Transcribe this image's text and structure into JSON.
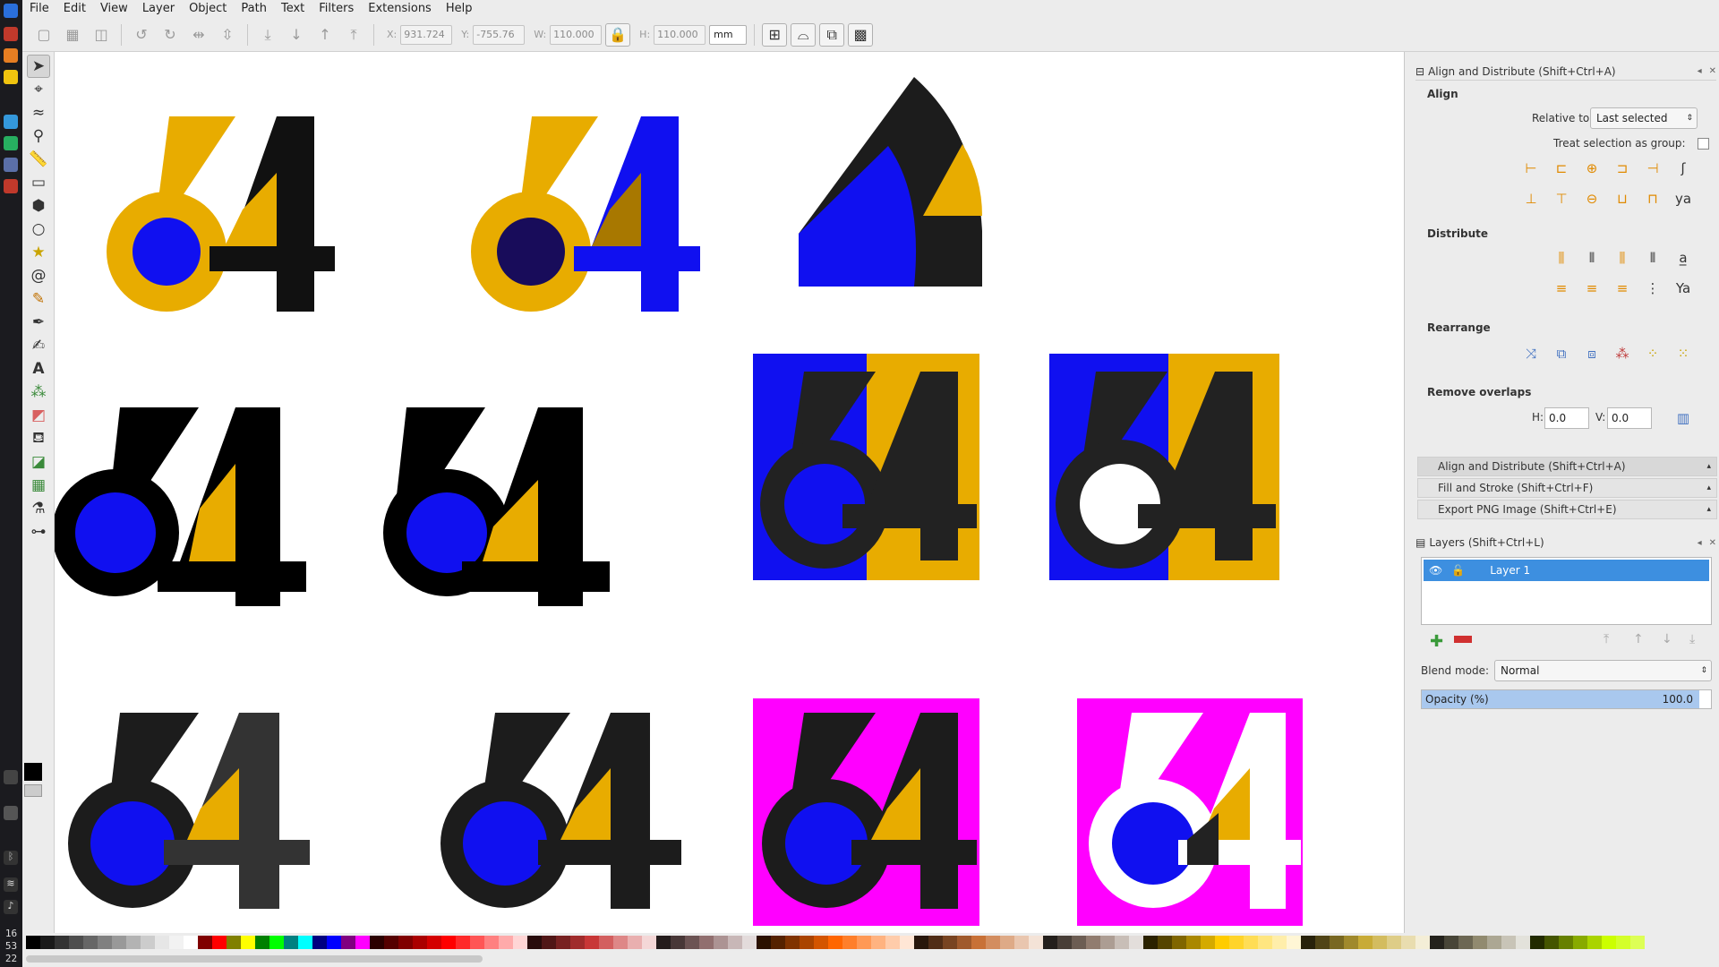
{
  "menubar": [
    "File",
    "Edit",
    "View",
    "Layer",
    "Object",
    "Path",
    "Text",
    "Filters",
    "Extensions",
    "Help"
  ],
  "toolbar": {
    "x_label": "X:",
    "x_value": "931.724",
    "y_label": "Y:",
    "y_value": "-755.76",
    "w_label": "W:",
    "w_value": "110.000",
    "h_label": "H:",
    "h_value": "110.000",
    "unit": "mm"
  },
  "clock": {
    "hour": "16",
    "minute": "53",
    "second": "22"
  },
  "tools": [
    "selector-tool",
    "node-tool",
    "tweak-tool",
    "zoom-tool",
    "measure-tool",
    "rectangle-tool",
    "3d-box-tool",
    "ellipse-tool",
    "star-tool",
    "spiral-tool",
    "pencil-tool",
    "pen-tool",
    "calligraphy-tool",
    "text-tool",
    "spray-tool",
    "eraser-tool",
    "paint-bucket-tool",
    "gradient-tool",
    "mesh-tool",
    "dropper-tool",
    "connector-tool"
  ],
  "align_panel": {
    "title": "Align and Distribute (Shift+Ctrl+A)",
    "align_heading": "Align",
    "relative_label": "Relative to:",
    "relative_value": "Last selected",
    "treat_group_label": "Treat selection as group:",
    "distribute_heading": "Distribute",
    "rearrange_heading": "Rearrange",
    "remove_overlaps_heading": "Remove overlaps",
    "h_label": "H:",
    "h_value": "0.0",
    "v_label": "V:",
    "v_value": "0.0"
  },
  "collapsed_docks": [
    "Align and Distribute (Shift+Ctrl+A)",
    "Fill and Stroke (Shift+Ctrl+F)",
    "Export PNG Image (Shift+Ctrl+E)"
  ],
  "layers_panel": {
    "title": "Layers (Shift+Ctrl+L)",
    "layer_name": "Layer 1",
    "blend_label": "Blend mode:",
    "blend_value": "Normal",
    "opacity_label": "Opacity (%)",
    "opacity_value": "100.0"
  },
  "colors": {
    "accent": "#e8ac00",
    "blue": "#1010f0",
    "magenta": "#ff00ff",
    "black": "#1c1c1c",
    "selection": "#3d8fe0"
  }
}
